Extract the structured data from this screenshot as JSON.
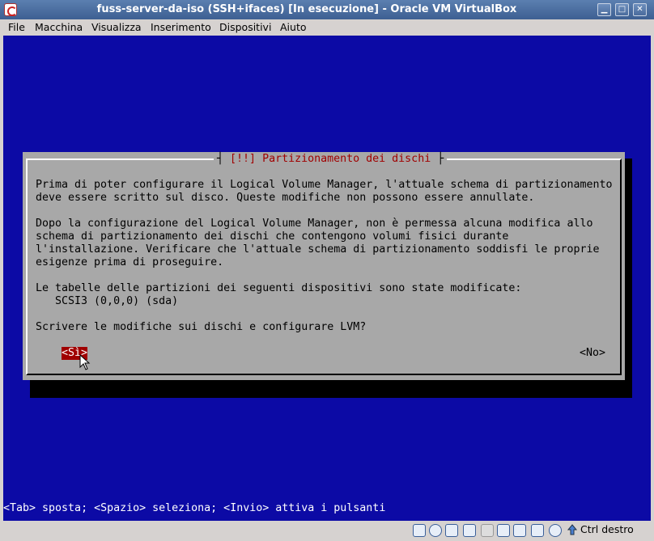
{
  "window": {
    "title": "fuss-server-da-iso (SSH+ifaces) [In esecuzione] - Oracle VM VirtualBox",
    "min_glyph": "▁",
    "max_glyph": "□",
    "close_glyph": "✕"
  },
  "menubar": {
    "items": [
      "File",
      "Macchina",
      "Visualizza",
      "Inserimento",
      "Dispositivi",
      "Aiuto"
    ]
  },
  "dialog": {
    "title_marker": "[!!]",
    "title_text": "Partizionamento dei dischi",
    "lines": [
      "Prima di poter configurare il Logical Volume Manager, l'attuale schema di partizionamento",
      "deve essere scritto sul disco. Queste modifiche non possono essere annullate.",
      "",
      "Dopo la configurazione del Logical Volume Manager, non è permessa alcuna modifica allo",
      "schema di partizionamento dei dischi che contengono volumi fisici durante",
      "l'installazione. Verificare che l'attuale schema di partizionamento soddisfi le proprie",
      "esigenze prima di proseguire.",
      "",
      "Le tabelle delle partizioni dei seguenti dispositivi sono state modificate:",
      "   SCSI3 (0,0,0) (sda)",
      "",
      "Scrivere le modifiche sui dischi e configurare LVM?"
    ],
    "yes_button": "<Sì>",
    "no_button": "<No>"
  },
  "hint_bar": "<Tab> sposta; <Spazio> seleziona; <Invio> attiva i pulsanti",
  "statusbar": {
    "host_key": "Ctrl destro",
    "icons": [
      "hard-disk-icon",
      "optical-drive-icon",
      "audio-icon",
      "network-icon",
      "usb-icon",
      "shared-folders-icon",
      "display-icon",
      "video-capture-icon",
      "cpu-icon",
      "mouse-integration-icon",
      "keyboard-icon"
    ]
  },
  "colors": {
    "screen_bg": "#0c0aa5",
    "dialog_bg": "#a8a8a8",
    "title_red": "#a00000",
    "selected_button_bg": "#a00000"
  }
}
